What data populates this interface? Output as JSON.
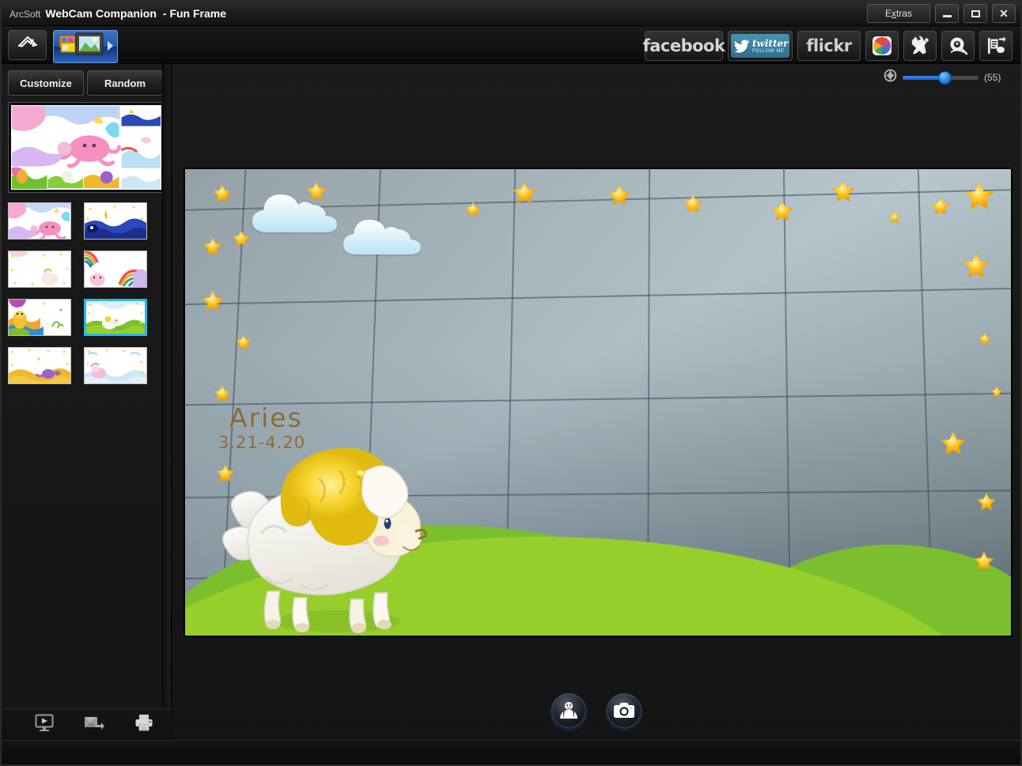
{
  "titlebar": {
    "brand": "ArcSoft",
    "app": "WebCam Companion",
    "mode": "- Fun Frame",
    "extras_label": "Extras",
    "minimize_label": "Minimize",
    "maximize_label": "Maximize",
    "close_label": "Close"
  },
  "toolbar": {
    "home_label": "Home",
    "mode_button_label": "Fun Frame",
    "social": [
      {
        "name": "facebook",
        "label": "facebook"
      },
      {
        "name": "twitter",
        "label": "twitter",
        "sublabel": "FOLLOW ME"
      },
      {
        "name": "flickr",
        "label": "flickr"
      },
      {
        "name": "picasa",
        "label": "Picasa"
      },
      {
        "name": "tools",
        "label": "Tools"
      },
      {
        "name": "search",
        "label": "Search"
      },
      {
        "name": "export",
        "label": "Export"
      }
    ]
  },
  "left_panel": {
    "customize_label": "Customize",
    "random_label": "Random",
    "preview_caption": "Fun Frame collage preview",
    "thumbnails": [
      {
        "name": "frame-octopus",
        "selected": false
      },
      {
        "name": "frame-whale",
        "selected": false
      },
      {
        "name": "frame-pastel",
        "selected": false
      },
      {
        "name": "frame-rainbow",
        "selected": false
      },
      {
        "name": "frame-tiger",
        "selected": false
      },
      {
        "name": "frame-aries",
        "selected": true
      },
      {
        "name": "frame-desert",
        "selected": false
      },
      {
        "name": "frame-water",
        "selected": false
      }
    ],
    "bottom_actions": [
      {
        "name": "slideshow",
        "label": "Slideshow"
      },
      {
        "name": "email",
        "label": "Send by E-mail"
      },
      {
        "name": "print",
        "label": "Print"
      }
    ]
  },
  "main": {
    "zoom": {
      "value_label": "(55)",
      "value": 55,
      "min": 0,
      "max": 100,
      "icon_label": "aperture-icon"
    },
    "frame_overlay": {
      "title": "Aries",
      "date_range": "3.21-4.20"
    },
    "capture_buttons": [
      {
        "name": "face-tracking",
        "label": "Face Tracking"
      },
      {
        "name": "capture-photo",
        "label": "Capture Photo"
      }
    ]
  },
  "colors": {
    "accent_blue": "#2ab6ef",
    "slider_blue": "#1f7ae0",
    "panel_bg": "#151515",
    "hill_front": "#96ce2c",
    "hill_back": "#7bbf2e",
    "star_yellow": "#ffc41e",
    "frame_text": "#8a6a33"
  }
}
